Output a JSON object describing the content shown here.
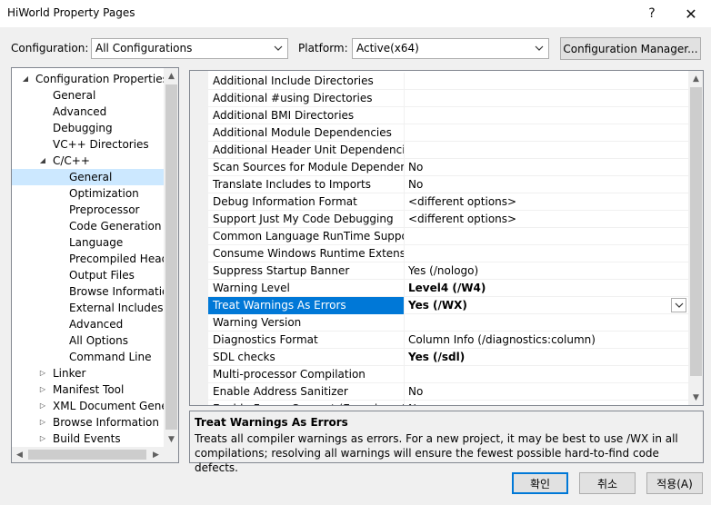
{
  "window": {
    "title": "HiWorld Property Pages",
    "help_glyph": "?",
    "close_glyph": "✕"
  },
  "toolbar": {
    "configuration_label": "Configuration:",
    "configuration_value": "All Configurations",
    "platform_label": "Platform:",
    "platform_value": "Active(x64)",
    "config_manager_label": "Configuration Manager..."
  },
  "tree": {
    "items": [
      {
        "label": "Configuration Properties",
        "level": 0,
        "toggle": "expanded"
      },
      {
        "label": "General",
        "level": 1
      },
      {
        "label": "Advanced",
        "level": 1
      },
      {
        "label": "Debugging",
        "level": 1
      },
      {
        "label": "VC++ Directories",
        "level": 1
      },
      {
        "label": "C/C++",
        "level": 1,
        "toggle": "expanded"
      },
      {
        "label": "General",
        "level": 2,
        "selected": true
      },
      {
        "label": "Optimization",
        "level": 2
      },
      {
        "label": "Preprocessor",
        "level": 2
      },
      {
        "label": "Code Generation",
        "level": 2
      },
      {
        "label": "Language",
        "level": 2
      },
      {
        "label": "Precompiled Headers",
        "level": 2
      },
      {
        "label": "Output Files",
        "level": 2
      },
      {
        "label": "Browse Information",
        "level": 2
      },
      {
        "label": "External Includes",
        "level": 2
      },
      {
        "label": "Advanced",
        "level": 2
      },
      {
        "label": "All Options",
        "level": 2
      },
      {
        "label": "Command Line",
        "level": 2
      },
      {
        "label": "Linker",
        "level": 1,
        "toggle": "collapsed"
      },
      {
        "label": "Manifest Tool",
        "level": 1,
        "toggle": "collapsed"
      },
      {
        "label": "XML Document Generator",
        "level": 1,
        "toggle": "collapsed"
      },
      {
        "label": "Browse Information",
        "level": 1,
        "toggle": "collapsed"
      },
      {
        "label": "Build Events",
        "level": 1,
        "toggle": "collapsed"
      }
    ]
  },
  "grid": {
    "rows": [
      {
        "name": "Additional Include Directories",
        "value": ""
      },
      {
        "name": "Additional #using Directories",
        "value": ""
      },
      {
        "name": "Additional BMI Directories",
        "value": ""
      },
      {
        "name": "Additional Module Dependencies",
        "value": ""
      },
      {
        "name": "Additional Header Unit Dependencies",
        "value": ""
      },
      {
        "name": "Scan Sources for Module Dependencies",
        "value": "No"
      },
      {
        "name": "Translate Includes to Imports",
        "value": "No"
      },
      {
        "name": "Debug Information Format",
        "value": "<different options>"
      },
      {
        "name": "Support Just My Code Debugging",
        "value": "<different options>"
      },
      {
        "name": "Common Language RunTime Support",
        "value": ""
      },
      {
        "name": "Consume Windows Runtime Extension",
        "value": ""
      },
      {
        "name": "Suppress Startup Banner",
        "value": "Yes (/nologo)"
      },
      {
        "name": "Warning Level",
        "value": "Level4 (/W4)",
        "bold": true
      },
      {
        "name": "Treat Warnings As Errors",
        "value": "Yes (/WX)",
        "bold": true,
        "selected": true
      },
      {
        "name": "Warning Version",
        "value": ""
      },
      {
        "name": "Diagnostics Format",
        "value": "Column Info (/diagnostics:column)"
      },
      {
        "name": "SDL checks",
        "value": "Yes (/sdl)",
        "bold": true
      },
      {
        "name": "Multi-processor Compilation",
        "value": ""
      },
      {
        "name": "Enable Address Sanitizer",
        "value": "No"
      },
      {
        "name": "Enable Fuzzer Support (Experimental)",
        "value": "No"
      }
    ]
  },
  "description": {
    "title": "Treat Warnings As Errors",
    "text": "Treats all compiler warnings as errors. For a new project, it may be best to use /WX in all compilations; resolving all warnings will ensure the fewest possible hard-to-find code defects."
  },
  "buttons": {
    "ok": "확인",
    "cancel": "취소",
    "apply": "적용(A)"
  },
  "colors": {
    "selection_blue": "#0078d7",
    "tree_selection": "#cce8ff"
  }
}
